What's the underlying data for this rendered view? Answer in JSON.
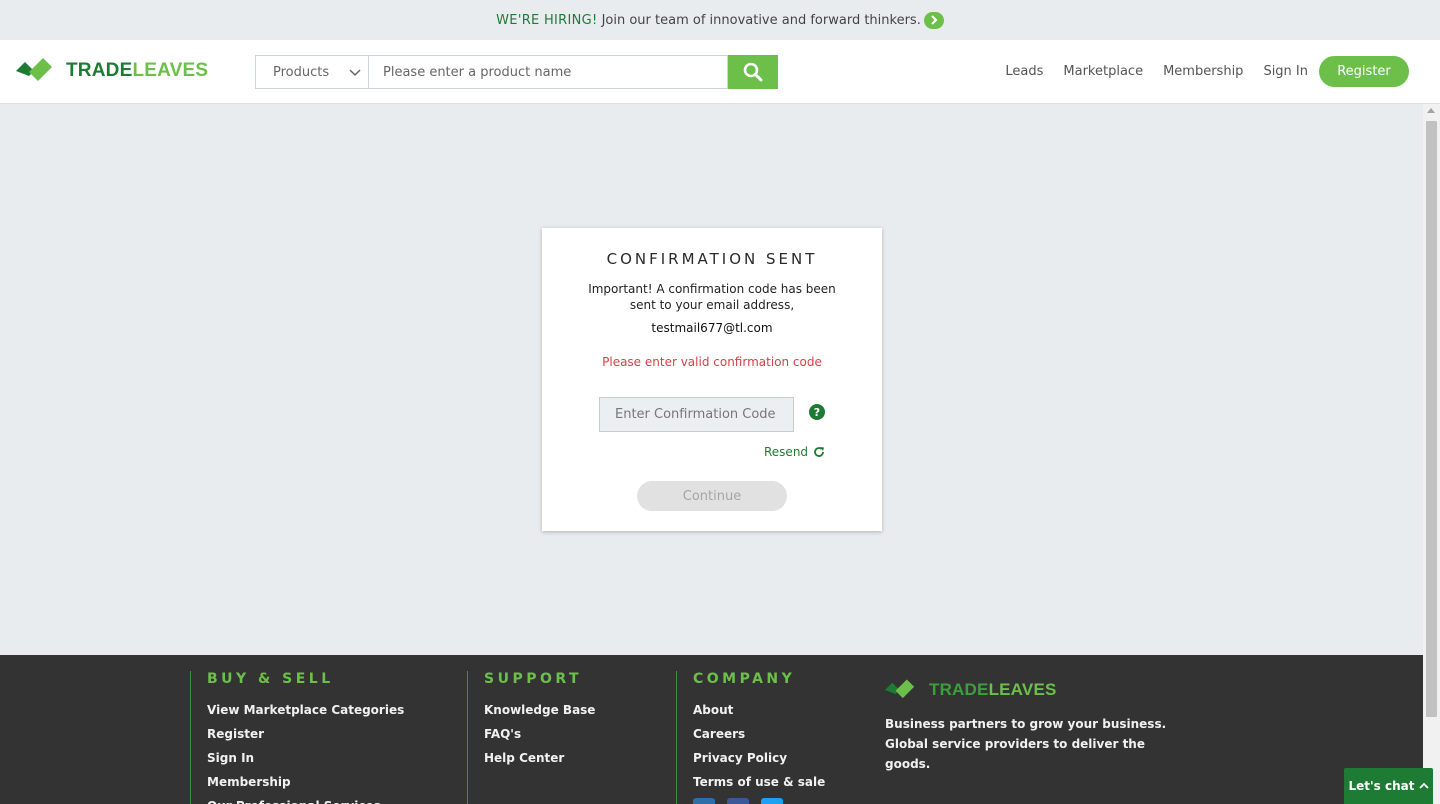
{
  "banner": {
    "highlight": "WE'RE HIRING!",
    "text": "Join our team of innovative and forward thinkers."
  },
  "brand": {
    "name_part1": "TRADE",
    "name_part2": "LEAVES"
  },
  "search": {
    "category": "Products",
    "placeholder": "Please enter a product name",
    "value": ""
  },
  "nav": {
    "leads": "Leads",
    "marketplace": "Marketplace",
    "membership": "Membership",
    "sign_in": "Sign In",
    "register": "Register"
  },
  "confirm": {
    "title": "CONFIRMATION SENT",
    "message": "Important! A confirmation code has been sent to your email address,",
    "email": "testmail677@tl.com",
    "error": "Please enter valid confirmation code",
    "code_placeholder": "Enter Confirmation Code",
    "help": "?",
    "resend": "Resend",
    "continue": "Continue"
  },
  "footer": {
    "buy_sell": {
      "heading": "BUY & SELL",
      "links": [
        "View Marketplace Categories",
        "Register",
        "Sign In",
        "Membership",
        "Our Professional Services"
      ]
    },
    "support": {
      "heading": "SUPPORT",
      "links": [
        "Knowledge Base",
        "FAQ's",
        "Help Center"
      ]
    },
    "company": {
      "heading": "COMPANY",
      "links": [
        "About",
        "Careers",
        "Privacy Policy",
        "Terms of use & sale"
      ]
    },
    "tagline": "Business partners to grow your business. Global service providers to deliver the goods."
  },
  "chat": {
    "label": "Let's chat"
  },
  "colors": {
    "primary_green": "#6cc04a",
    "dark_green": "#1e7b34",
    "error_red": "#d2424a",
    "footer_bg": "#333333"
  }
}
